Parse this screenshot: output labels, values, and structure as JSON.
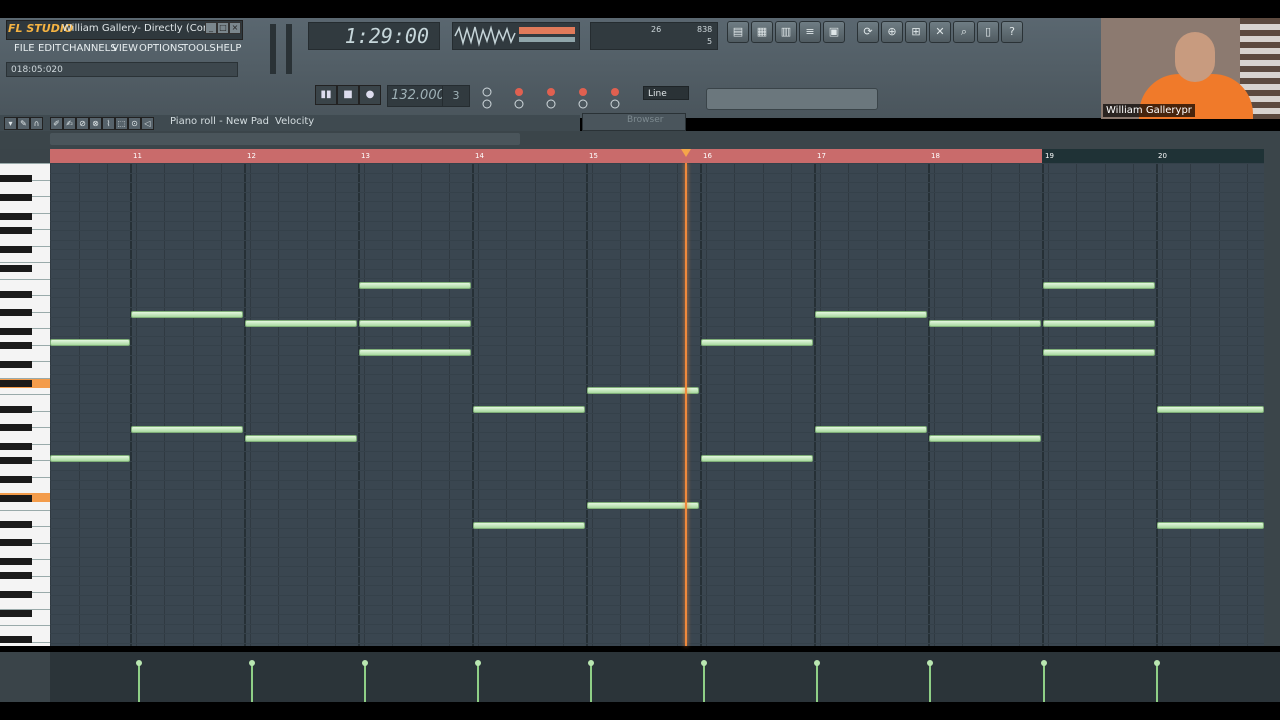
{
  "app": {
    "logo": "FL STUDIO",
    "window_title": "William Gallery- Directly (Com...",
    "hint_text": "018:05:020"
  },
  "menu": [
    "FILE",
    "EDIT",
    "CHANNELS",
    "VIEW",
    "OPTIONS",
    "TOOLS",
    "HELP"
  ],
  "transport": {
    "time": "1:29:00",
    "tempo": "132.000",
    "pattern": "3",
    "snap": "Line",
    "cpu_value": "26",
    "mem_value": "838",
    "poly_value": "5"
  },
  "browser": {
    "label": "Browser"
  },
  "piano_roll": {
    "title": "Piano roll - New Pad",
    "target": "Velocity",
    "bars": [
      "11",
      "12",
      "13",
      "14",
      "15",
      "16",
      "17",
      "18",
      "19",
      "20"
    ],
    "playhead_bar": "16"
  },
  "webcam": {
    "name": "William Gallerypr"
  },
  "icons": {
    "toolbar": [
      "play-icon",
      "stop-icon",
      "record-icon",
      "mixer-icon",
      "channel-rack-icon",
      "piano-icon",
      "playlist-icon",
      "browser-icon",
      "refresh-icon",
      "plugin-icon",
      "save-icon",
      "cut-icon",
      "search-icon",
      "document-icon",
      "help-icon"
    ]
  },
  "colors": {
    "note": "#c9ecc1",
    "playhead": "#f0893c",
    "loop_ruler": "#c96b6b",
    "highlight_key": "#f39c4b"
  }
}
